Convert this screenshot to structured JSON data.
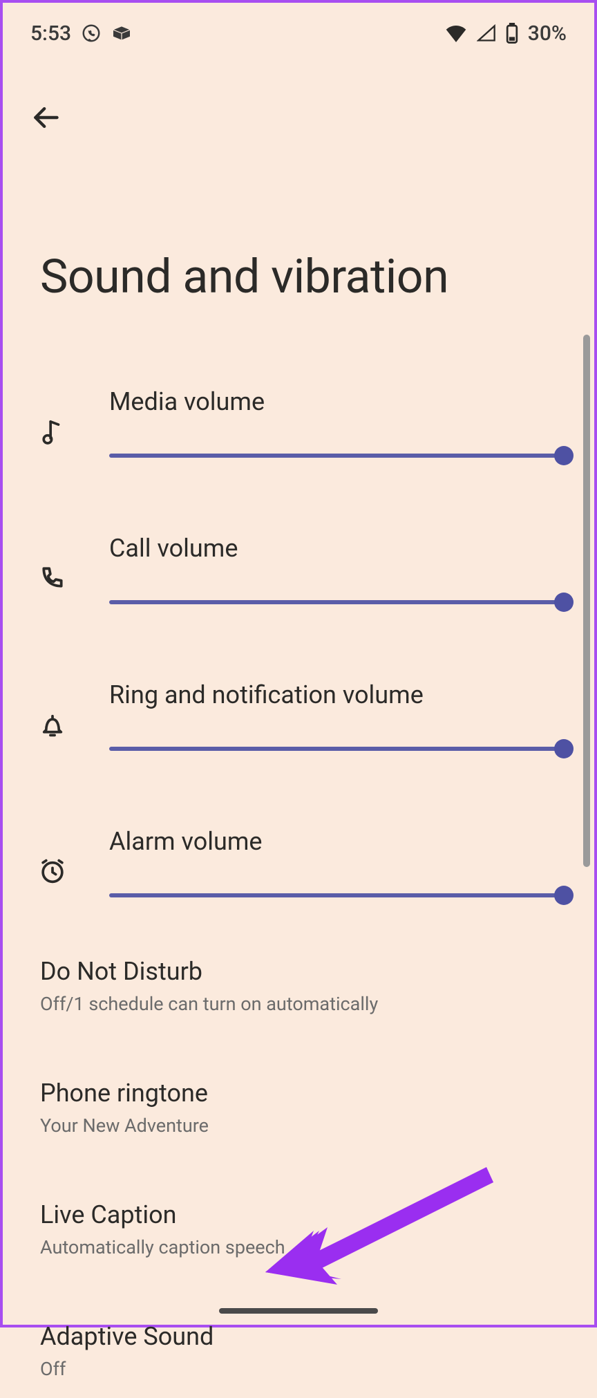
{
  "status": {
    "time": "5:53",
    "battery": "30%"
  },
  "page": {
    "title": "Sound and vibration"
  },
  "sliders": [
    {
      "label": "Media volume",
      "value": 100
    },
    {
      "label": "Call volume",
      "value": 100
    },
    {
      "label": "Ring and notification volume",
      "value": 100
    },
    {
      "label": "Alarm volume",
      "value": 100
    }
  ],
  "settings": {
    "dnd": {
      "title": "Do Not Disturb",
      "sub": "Off/1 schedule can turn on automatically"
    },
    "ringtone": {
      "title": "Phone ringtone",
      "sub": "Your New Adventure"
    },
    "livecaption": {
      "title": "Live Caption",
      "sub": "Automatically caption speech"
    },
    "adaptive": {
      "title": "Adaptive Sound",
      "sub": "Off"
    }
  }
}
